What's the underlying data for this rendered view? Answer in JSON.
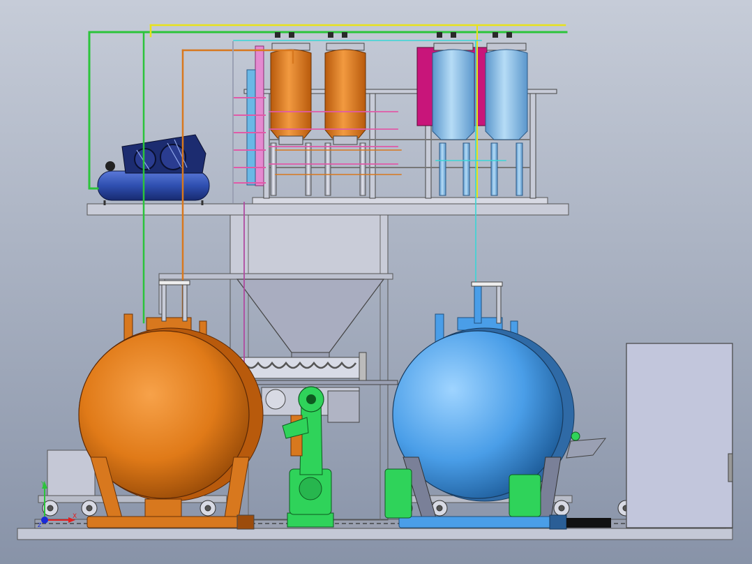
{
  "viewport": {
    "background_top": "#c6ccd8",
    "background_bottom": "#8893a8"
  },
  "triad": {
    "x_label": "X",
    "y_label": "Y",
    "z_label": "Z"
  },
  "colors": {
    "orange_vessel": "#e07a18",
    "blue_vessel": "#4a9ee8",
    "robot_green": "#2fd35a",
    "compressor_blue": "#2f4fb0",
    "platform_grey": "#c9ccd8",
    "pipe_green": "#2bc43a",
    "pipe_yellow": "#e8e21a",
    "pipe_orange": "#d8781e",
    "pipe_pink": "#e05aa8",
    "pipe_cyan": "#39d6d6",
    "magenta_panel": "#c8157a"
  },
  "icons": [
    "coordinate-triad-icon"
  ]
}
